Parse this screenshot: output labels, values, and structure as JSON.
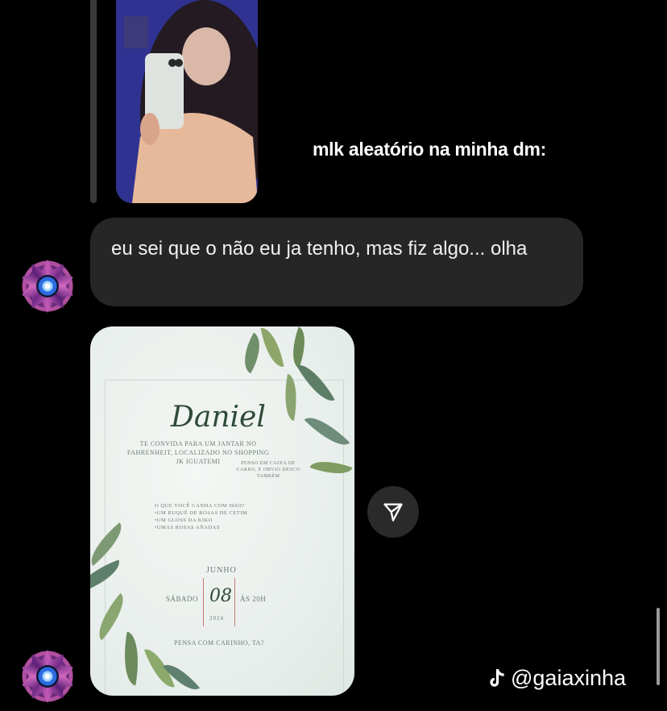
{
  "overlay": {
    "caption": "mlk aleatório na minha dm:"
  },
  "messages": [
    {
      "type": "text",
      "text": "eu sei que o não eu ja tenho, mas fiz algo... olha"
    },
    {
      "type": "image"
    }
  ],
  "invite": {
    "name": "Daniel",
    "invite_text": "TE CONVIDA PARA UM JANTAR NO FAHRENHEIT, LOCALIZADO NO SHOPPING JK IGUATEMI",
    "side_note": "PENSO EM CAIXA DE CARRO, E OBVIO DESCO TAMBÉM",
    "gifts": "O QUE VOCÊ GANHA COM ISSO?\n•UM BUQUÊ DE ROSAS DE CETIM\n•UM GLOSS DA KIKO\n•UMAS ROSAS AÑADAS",
    "side_note2": "",
    "month": "JUNHO",
    "weekday": "SÁBADO",
    "day": "08",
    "time": "ÀS 20H",
    "year": "2024",
    "footer": "PENSA COM CARINHO, TA?"
  },
  "watermark": {
    "handle": "@gaiaxinha",
    "icon": "tiktok-icon"
  },
  "icons": {
    "share": "paper-plane-icon"
  }
}
